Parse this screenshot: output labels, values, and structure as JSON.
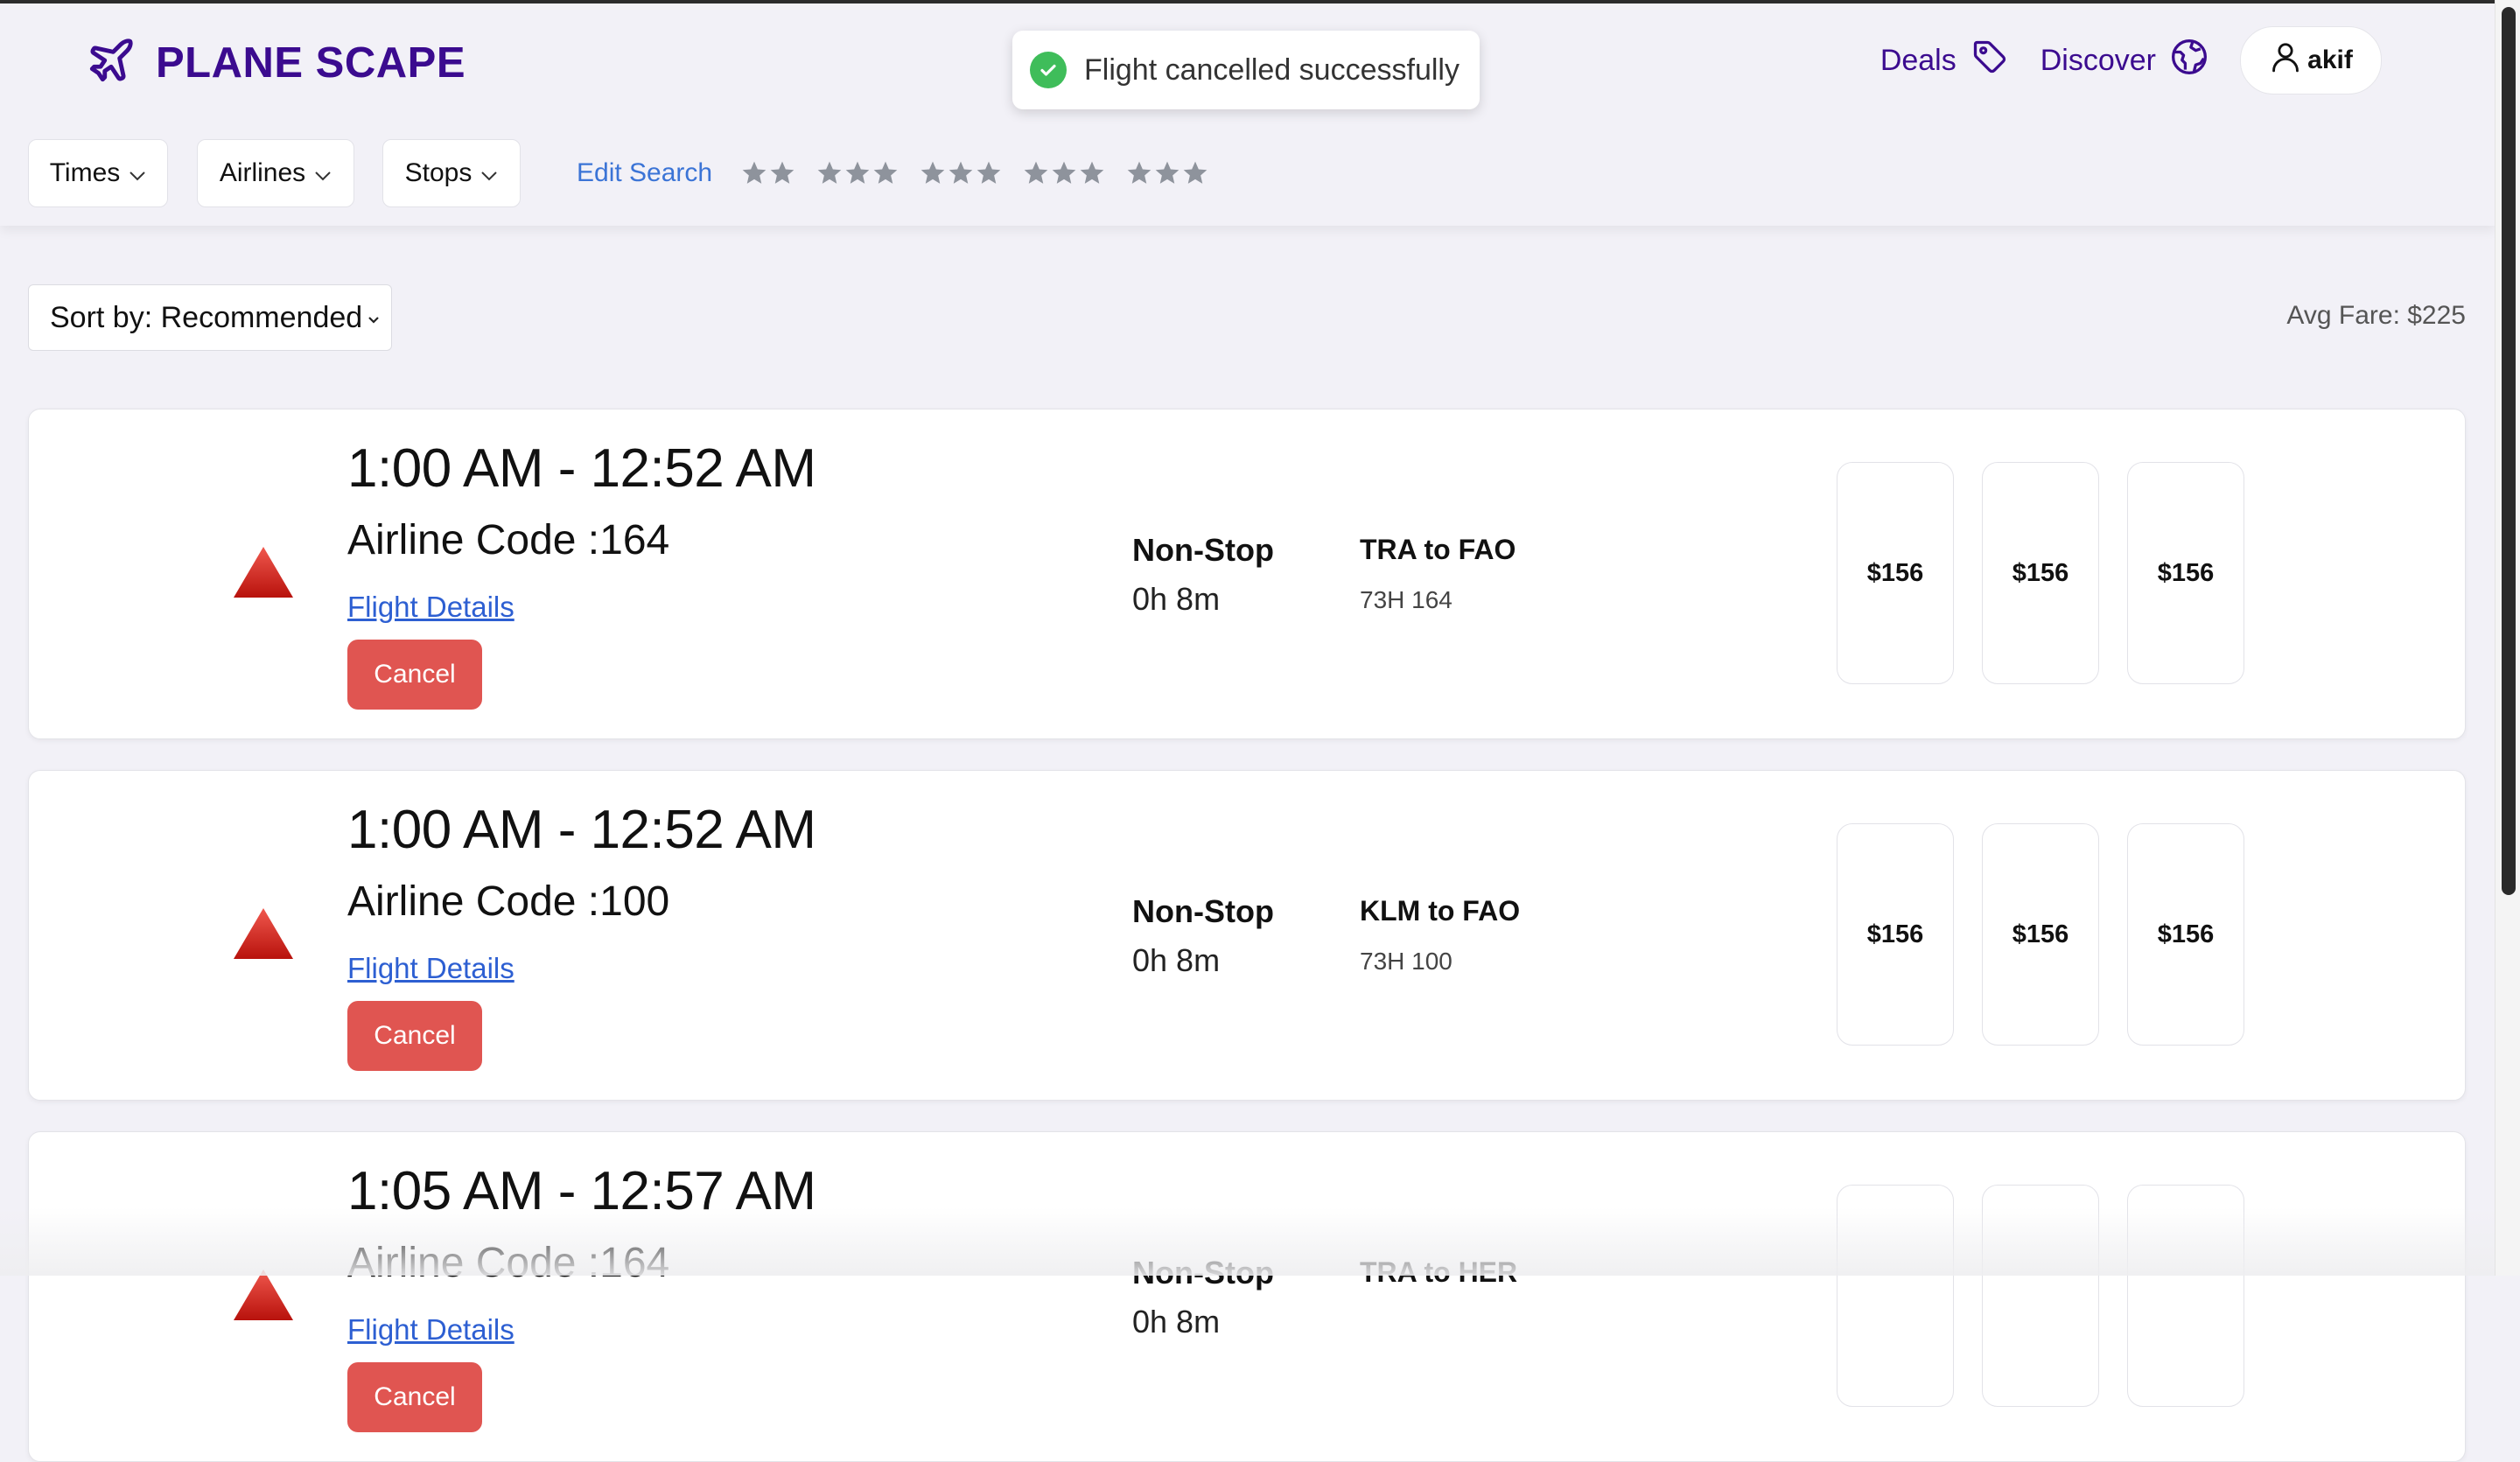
{
  "app": {
    "brand": "PLANE SCAPE",
    "brand_color": "#3b0b8f",
    "logo_icon": "plane-icon"
  },
  "toast": {
    "message": "Flight cancelled successfully",
    "status_color": "#3fbd5a",
    "icon": "check-circle-icon"
  },
  "nav": {
    "deals_label": "Deals",
    "deals_icon": "tag-icon",
    "discover_label": "Discover",
    "discover_icon": "globe-icon",
    "user_name": "akif",
    "user_icon": "user-icon"
  },
  "filters": {
    "times_label": "Times",
    "airlines_label": "Airlines",
    "stops_label": "Stops",
    "edit_search_label": "Edit Search",
    "star_ratings": [
      2,
      3,
      3,
      3,
      3
    ]
  },
  "sort": {
    "label": "Sort by: Recommended"
  },
  "summary": {
    "avg_fare": "Avg Fare: $225"
  },
  "flights": [
    {
      "times": "1:00 AM - 12:52 AM",
      "airline_code": "Airline Code :164",
      "details_label": "Flight Details",
      "cancel_label": "Cancel",
      "stops": "Non-Stop",
      "duration": "0h 8m",
      "route": "TRA to FAO",
      "flight_no": "73H 164",
      "prices": [
        "$156",
        "$156",
        "$156"
      ]
    },
    {
      "times": "1:00 AM - 12:52 AM",
      "airline_code": "Airline Code :100",
      "details_label": "Flight Details",
      "cancel_label": "Cancel",
      "stops": "Non-Stop",
      "duration": "0h 8m",
      "route": "KLM to FAO",
      "flight_no": "73H 100",
      "prices": [
        "$156",
        "$156",
        "$156"
      ]
    },
    {
      "times": "1:05 AM - 12:57 AM",
      "airline_code": "Airline Code :164",
      "details_label": "Flight Details",
      "cancel_label": "Cancel",
      "stops": "Non-Stop",
      "duration": "0h 8m",
      "route": "TRA to HER",
      "flight_no": "",
      "prices": [
        "",
        "",
        ""
      ]
    }
  ],
  "colors": {
    "cancel_button": "#e05551",
    "link": "#2d5fd2",
    "airline_marker": "#d9201a"
  }
}
